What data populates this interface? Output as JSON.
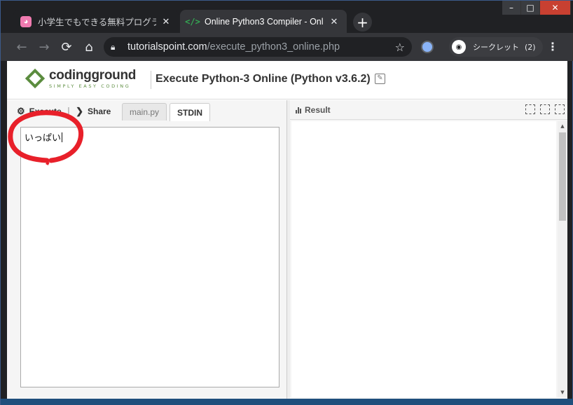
{
  "window": {
    "controls": {
      "minimize": "–",
      "maximize": "□",
      "close": "✕"
    }
  },
  "tabs": [
    {
      "title": "小学生でもできる無料プログラミ",
      "favicon": "pig-icon",
      "close": "✕"
    },
    {
      "title": "Online Python3 Compiler - Onl",
      "favicon": "code-icon",
      "close": "✕"
    }
  ],
  "newtab_label": "+",
  "toolbar": {
    "back": "←",
    "forward": "→",
    "reload": "⟳",
    "home": "⌂",
    "url_host": "tutorialspoint.com",
    "url_path": "/execute_python3_online.php",
    "star": "☆",
    "incognito_label": "シークレット",
    "incognito_count": "(2)",
    "menu": "⋮"
  },
  "header": {
    "logo_name": "codingground",
    "logo_tagline": "SIMPLY EASY CODING",
    "title": "Execute Python-3 Online (Python v3.6.2)"
  },
  "editor": {
    "execute_label": "Execute",
    "share_label": "Share",
    "tabs": [
      "main.py",
      "STDIN"
    ],
    "active_tab": "STDIN",
    "stdin_value": "いっぱい"
  },
  "result": {
    "label": "Result",
    "output": ""
  },
  "colors": {
    "chrome_dark": "#202124",
    "chrome_toolbar": "#35363a",
    "brand_green": "#5b8c3e",
    "annotation_red": "#e8202a"
  }
}
